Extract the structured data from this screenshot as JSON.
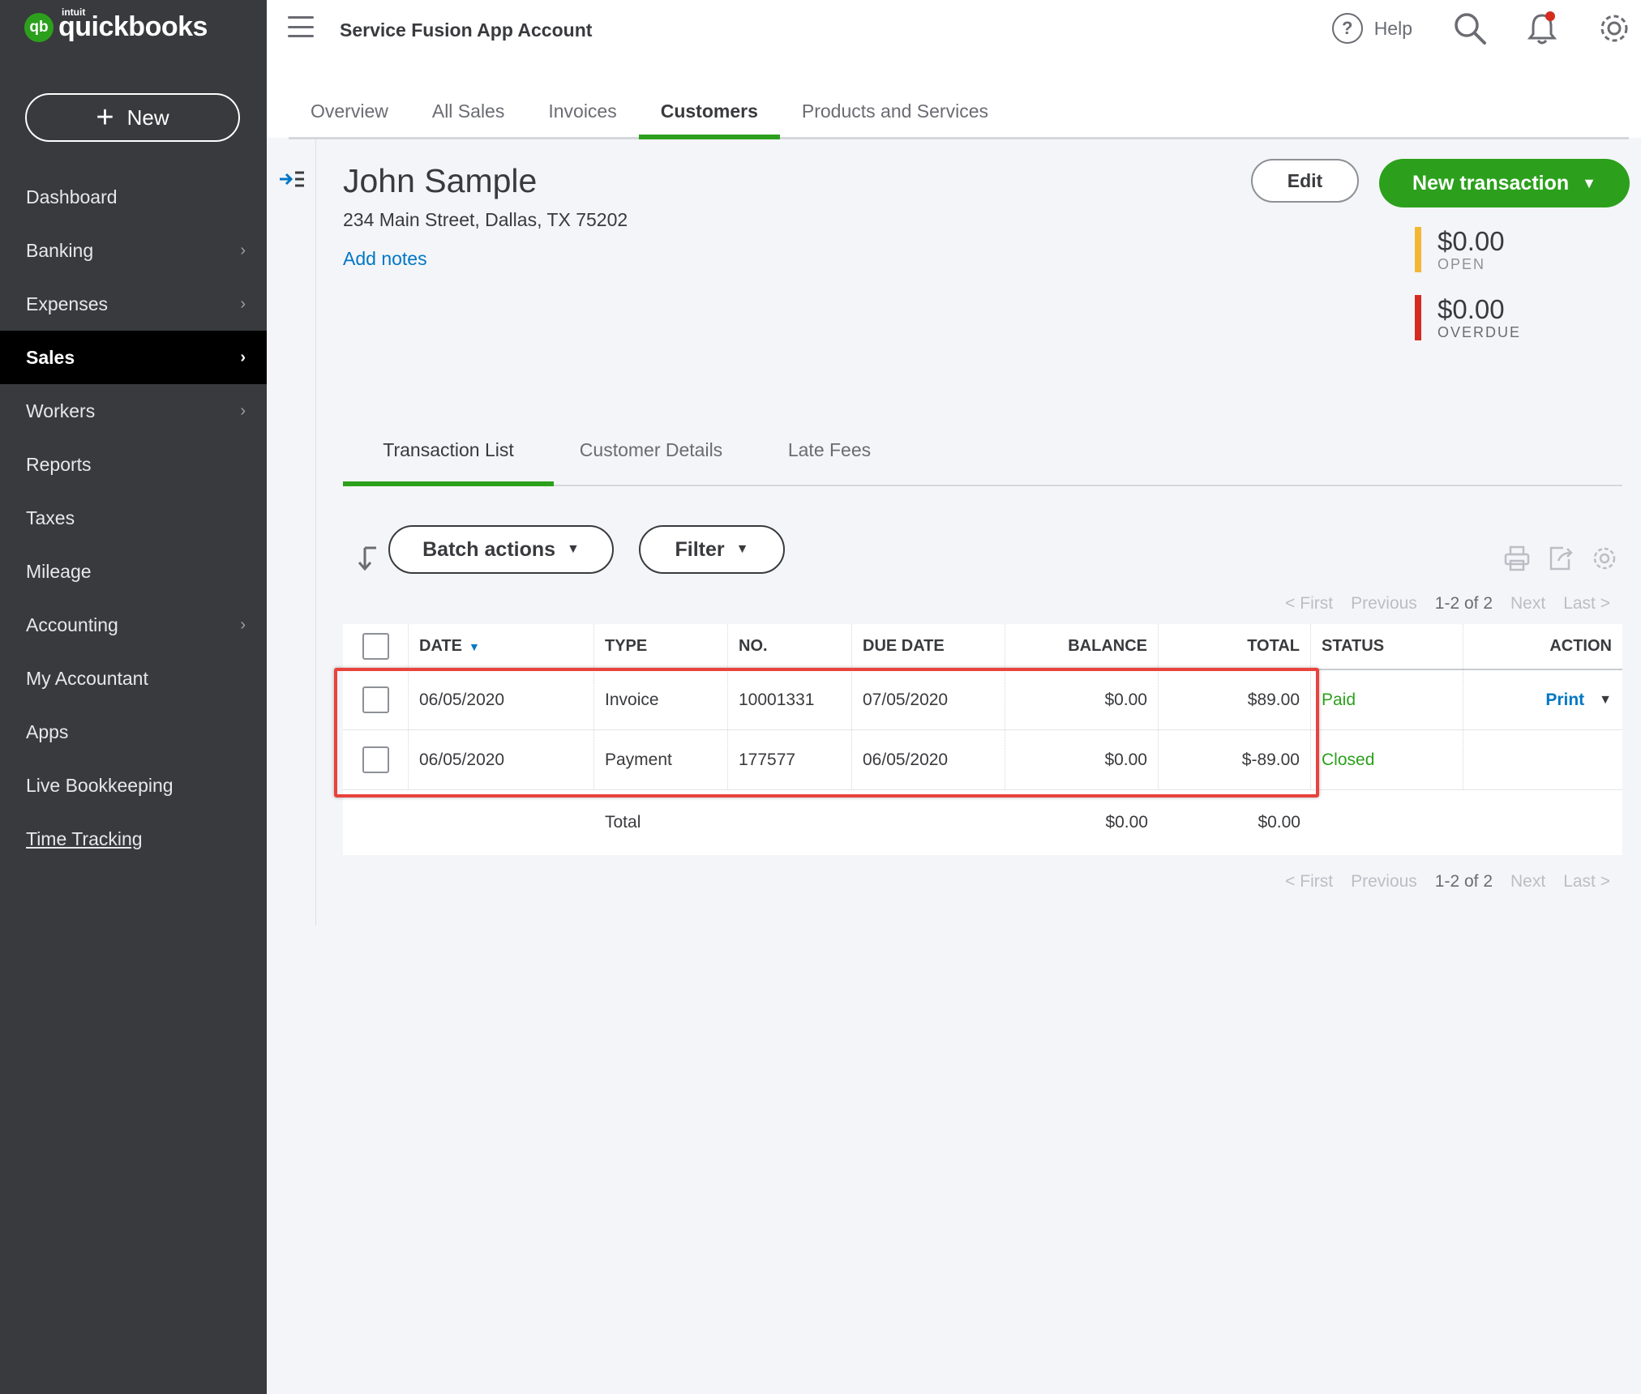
{
  "brand": {
    "badge": "qb",
    "intuit": "intuit",
    "name": "quickbooks"
  },
  "sidebar": {
    "new_label": "New",
    "items": [
      {
        "label": "Dashboard",
        "chevron": false,
        "active": false
      },
      {
        "label": "Banking",
        "chevron": true,
        "active": false
      },
      {
        "label": "Expenses",
        "chevron": true,
        "active": false
      },
      {
        "label": "Sales",
        "chevron": true,
        "active": true
      },
      {
        "label": "Workers",
        "chevron": true,
        "active": false
      },
      {
        "label": "Reports",
        "chevron": false,
        "active": false
      },
      {
        "label": "Taxes",
        "chevron": false,
        "active": false
      },
      {
        "label": "Mileage",
        "chevron": false,
        "active": false
      },
      {
        "label": "Accounting",
        "chevron": true,
        "active": false
      },
      {
        "label": "My Accountant",
        "chevron": false,
        "active": false
      },
      {
        "label": "Apps",
        "chevron": false,
        "active": false
      },
      {
        "label": "Live Bookkeeping",
        "chevron": false,
        "active": false
      },
      {
        "label": "Time Tracking",
        "chevron": false,
        "active": false
      }
    ]
  },
  "header": {
    "company": "Service Fusion App Account",
    "help_label": "Help",
    "help_glyph": "?",
    "tabs": [
      "Overview",
      "All Sales",
      "Invoices",
      "Customers",
      "Products and Services"
    ],
    "active_tab": "Customers"
  },
  "customer": {
    "name": "John Sample",
    "address": "234 Main Street, Dallas, TX 75202",
    "add_notes": "Add notes",
    "edit_label": "Edit",
    "new_transaction_label": "New transaction",
    "open_amount": "$0.00",
    "open_label": "OPEN",
    "overdue_amount": "$0.00",
    "overdue_label": "OVERDUE",
    "colors": {
      "open": "#f2b835",
      "overdue": "#d52b1e",
      "accent": "#2ca01c",
      "link": "#0077c5",
      "highlight": "#e8433d"
    }
  },
  "content_tabs": [
    "Transaction List",
    "Customer Details",
    "Late Fees"
  ],
  "toolbar": {
    "batch_label": "Batch actions",
    "filter_label": "Filter",
    "icons": [
      "print-icon",
      "export-icon",
      "settings-icon"
    ]
  },
  "pager": {
    "first": "< First",
    "previous": "Previous",
    "count": "1-2 of 2",
    "next": "Next",
    "last": "Last >"
  },
  "table": {
    "columns": [
      "DATE",
      "TYPE",
      "NO.",
      "DUE DATE",
      "BALANCE",
      "TOTAL",
      "STATUS",
      "ACTION"
    ],
    "rows": [
      {
        "date": "06/05/2020",
        "type": "Invoice",
        "no": "10001331",
        "due": "07/05/2020",
        "balance": "$0.00",
        "total": "$89.00",
        "status": "Paid",
        "action": "Print"
      },
      {
        "date": "06/05/2020",
        "type": "Payment",
        "no": "177577",
        "due": "06/05/2020",
        "balance": "$0.00",
        "total": "$-89.00",
        "status": "Closed",
        "action": ""
      }
    ],
    "total_label": "Total",
    "total_balance": "$0.00",
    "total_total": "$0.00"
  }
}
